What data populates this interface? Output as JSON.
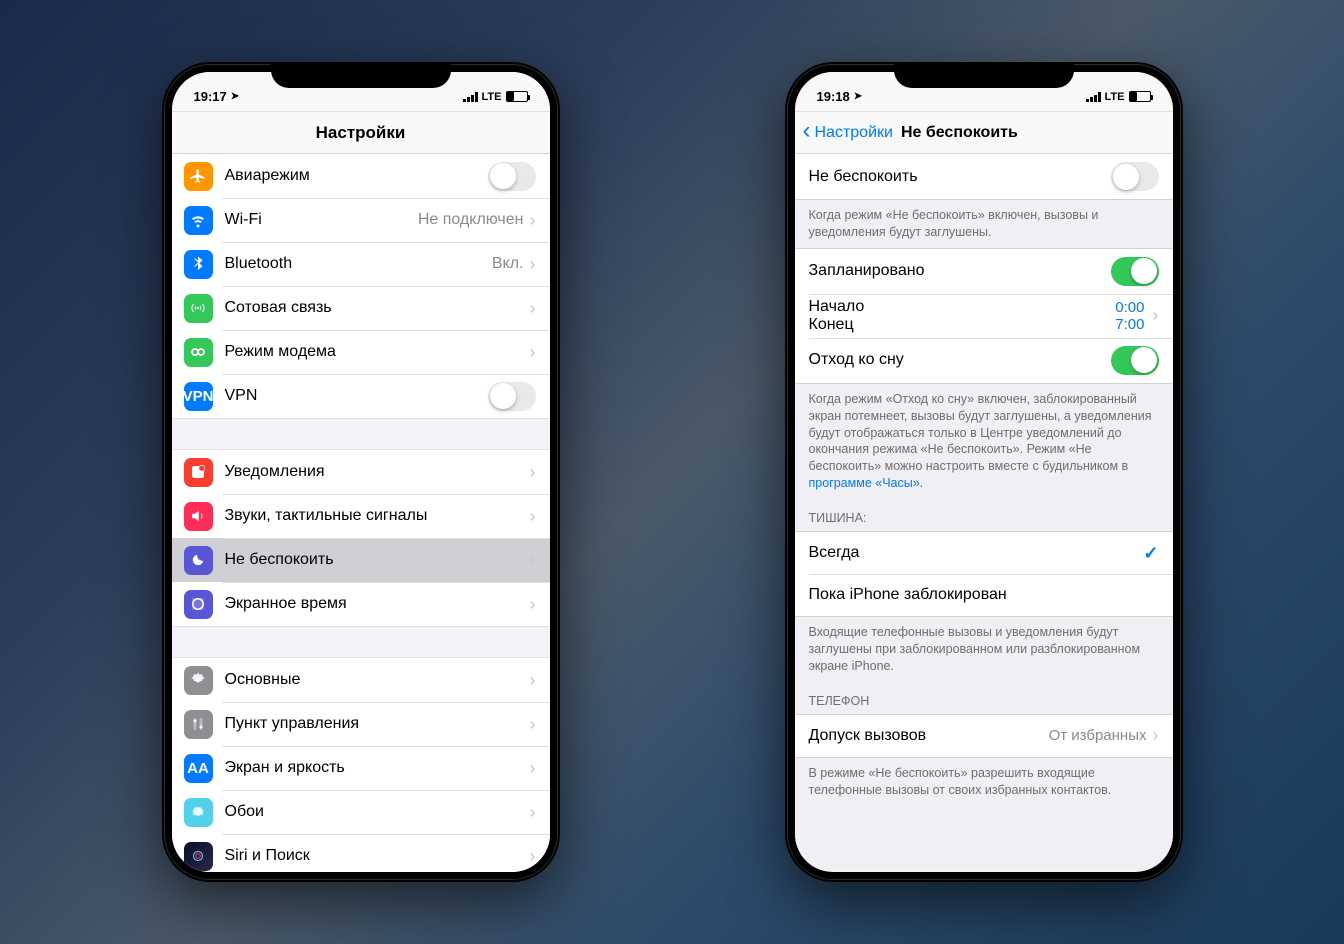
{
  "left": {
    "status": {
      "time": "19:17",
      "network": "LTE"
    },
    "title": "Настройки",
    "rows": {
      "airplane": {
        "label": "Авиарежим"
      },
      "wifi": {
        "label": "Wi-Fi",
        "value": "Не подключен"
      },
      "bt": {
        "label": "Bluetooth",
        "value": "Вкл."
      },
      "cellular": {
        "label": "Сотовая связь"
      },
      "hotspot": {
        "label": "Режим модема"
      },
      "vpn": {
        "label": "VPN",
        "icon": "VPN"
      },
      "notif": {
        "label": "Уведомления"
      },
      "sound": {
        "label": "Звуки, тактильные сигналы"
      },
      "dnd": {
        "label": "Не беспокоить"
      },
      "screentime": {
        "label": "Экранное время"
      },
      "general": {
        "label": "Основные"
      },
      "control": {
        "label": "Пункт управления"
      },
      "display": {
        "label": "Экран и яркость",
        "icon": "AA"
      },
      "wallpaper": {
        "label": "Обои"
      },
      "siri": {
        "label": "Siri и Поиск"
      }
    }
  },
  "right": {
    "status": {
      "time": "19:18",
      "network": "LTE"
    },
    "back": "Настройки",
    "title": "Не беспокоить",
    "dnd_row": "Не беспокоить",
    "dnd_footer": "Когда режим «Не беспокоить» включен, вызовы и уведомления будут заглушены.",
    "scheduled": "Запланировано",
    "start_label": "Начало",
    "end_label": "Конец",
    "start_time": "0:00",
    "end_time": "7:00",
    "bedtime": "Отход ко сну",
    "bedtime_footer_1": "Когда режим «Отход ко сну» включен, заблокированный экран потемнеет, вызовы будут заглушены, а уведомления будут отображаться только в Центре уведомлений до окончания режима «Не беспокоить». Режим «Не беспокоить» можно настроить вместе с будильником в ",
    "bedtime_footer_link": "программе «Часы».",
    "silence_header": "ТИШИНА:",
    "silence_always": "Всегда",
    "silence_locked": "Пока iPhone заблокирован",
    "silence_footer": "Входящие телефонные вызовы и уведомления будут заглушены при заблокированном или разблокированном экране iPhone.",
    "phone_header": "ТЕЛЕФОН",
    "allow_label": "Допуск вызовов",
    "allow_value": "От избранных",
    "allow_footer": "В режиме «Не беспокоить» разрешить входящие телефонные вызовы от своих избранных контактов."
  }
}
